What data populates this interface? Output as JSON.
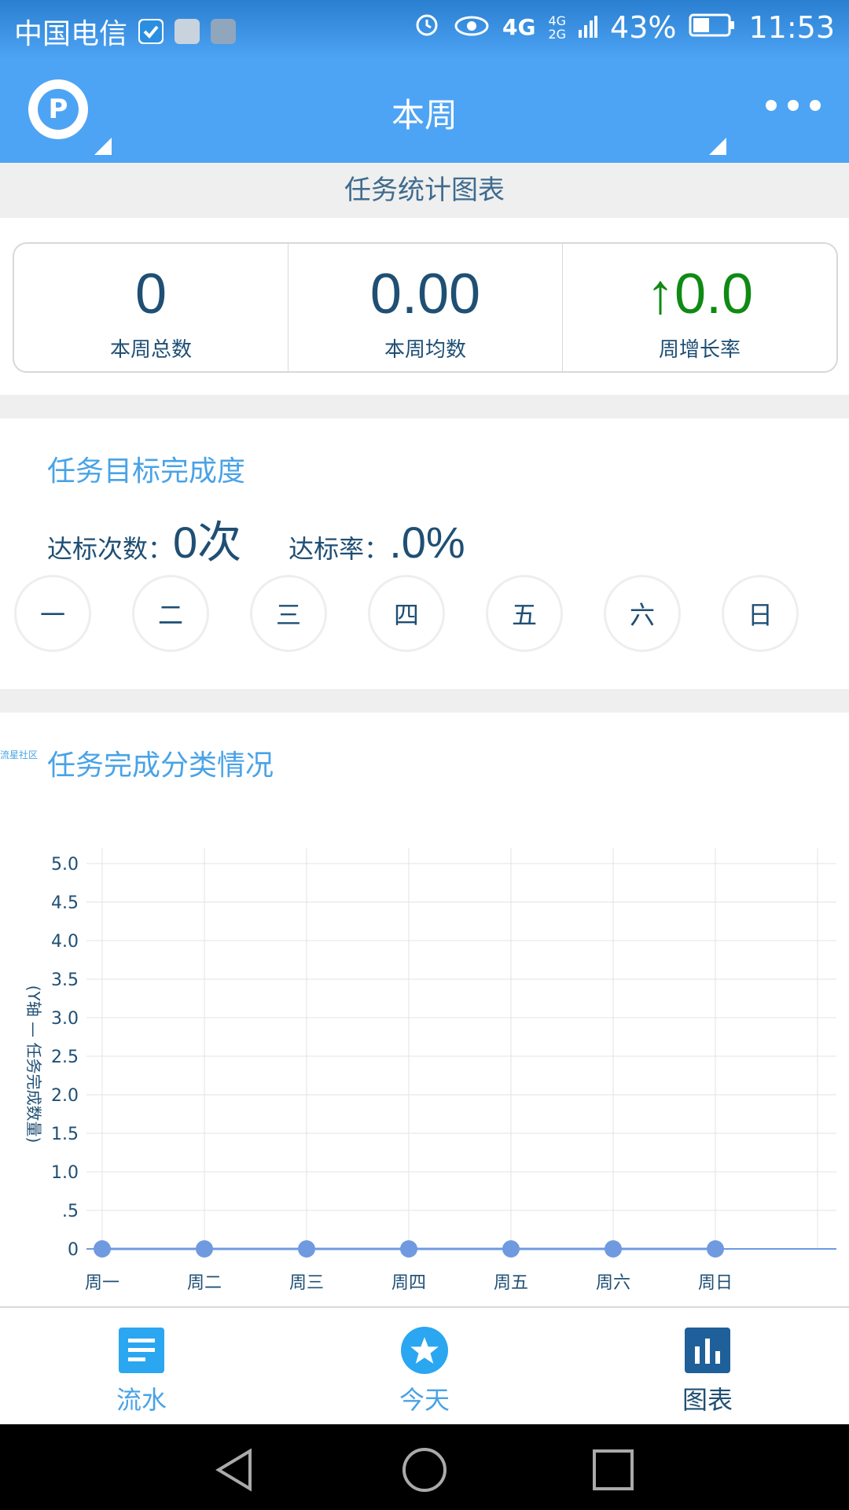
{
  "status_bar": {
    "carrier": "中国电信",
    "network_1": "4G",
    "network_2": "4G",
    "network_3": "2G",
    "battery": "43%",
    "time": "11:53"
  },
  "app_bar": {
    "title": "本周",
    "logo_letter": "P"
  },
  "section_header": "任务统计图表",
  "stats": [
    {
      "value": "0",
      "label": "本周总数"
    },
    {
      "value": "0.00",
      "label": "本周均数"
    },
    {
      "value": "↑0.0",
      "label": "周增长率"
    }
  ],
  "target": {
    "title": "任务目标完成度",
    "count_label": "达标次数：",
    "count_value": "0次",
    "rate_label": "达标率：",
    "rate_value": ".0%"
  },
  "weekdays": [
    "一",
    "二",
    "三",
    "四",
    "五",
    "六",
    "日"
  ],
  "watermark": "流星社区",
  "chart_title": "任务完成分类情况",
  "chart_data": {
    "type": "line",
    "categories": [
      "周一",
      "周二",
      "周三",
      "周四",
      "周五",
      "周六",
      "周日"
    ],
    "series": [
      {
        "values": [
          0,
          0,
          0,
          0,
          0,
          0,
          0
        ]
      }
    ],
    "ylabel": "(Y轴 — 任务完成数量)",
    "xlabel": "",
    "ylim": [
      0,
      5
    ],
    "yticks": [
      "0",
      ".5",
      "1.0",
      "1.5",
      "2.0",
      "2.5",
      "3.0",
      "3.5",
      "4.0",
      "4.5",
      "5.0"
    ],
    "grid": true,
    "colors": {
      "line": "#6f9ae0",
      "point": "#6f9ae0",
      "grid": "#e3e3e3",
      "text": "#1f4f74"
    }
  },
  "bottom_nav": [
    {
      "label": "流水",
      "icon": "list-icon"
    },
    {
      "label": "今天",
      "icon": "star-icon"
    },
    {
      "label": "图表",
      "icon": "bar-chart-icon"
    }
  ],
  "colors": {
    "primary": "#4ea4f4",
    "dark_text": "#1f4f74",
    "accent_text": "#49a3e6",
    "green": "#0f8a14"
  }
}
